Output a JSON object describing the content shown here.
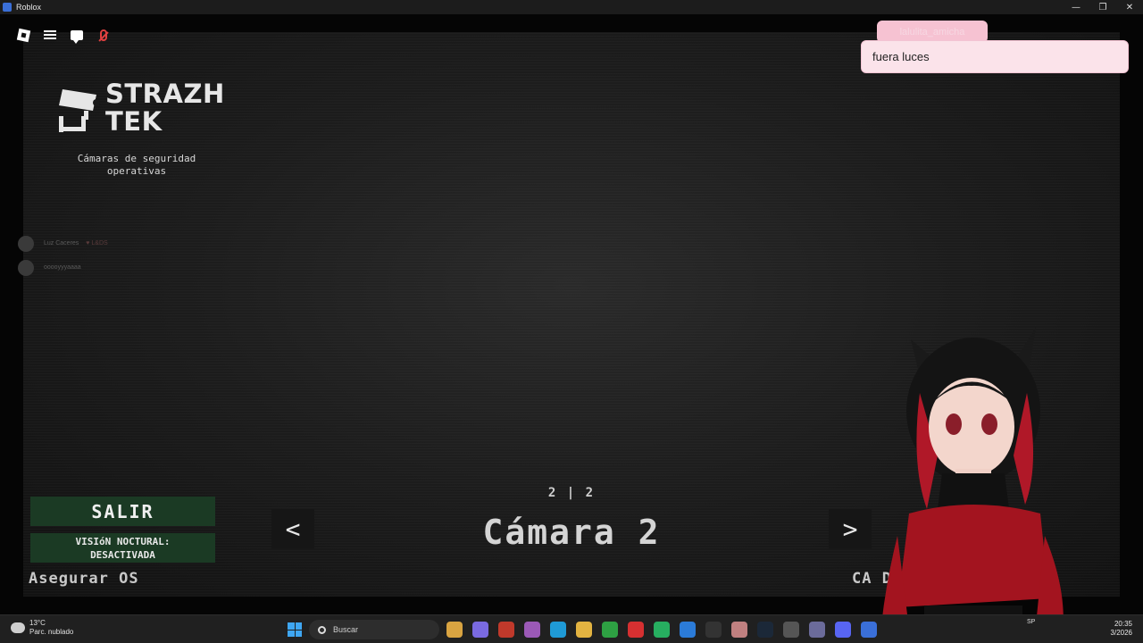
{
  "window": {
    "title": "Roblox",
    "controls": [
      "—",
      "❐",
      "✕"
    ]
  },
  "roblox_bar": {
    "icons": [
      "roblox-logo-icon",
      "menu-icon",
      "chat-icon",
      "mic-muted-icon"
    ]
  },
  "logo": {
    "line1": "STRAZH",
    "line2": "TEK",
    "subtitle_line1": "Cámaras de seguridad",
    "subtitle_line2": "operativas"
  },
  "players": [
    {
      "name": "Luz Caceres",
      "tag": "♥ L&DS"
    },
    {
      "name": "ooooyyyaaaa",
      "tag": ""
    }
  ],
  "chat": {
    "speaker": "lalulita_amicha",
    "message": "fuera luces"
  },
  "buttons": {
    "salir": "SALIR",
    "vision_line1": "VISIóN NOCTURAL:",
    "vision_line2": "DESACTIVADA",
    "asegurar": "Asegurar OS"
  },
  "camera": {
    "counter": "2 | 2",
    "name": "Cámara 2",
    "prev": "<",
    "next": ">",
    "right_label": "CA                    DAD"
  },
  "taskbar": {
    "weather_temp": "13°C",
    "weather_desc": "Parc. nublado",
    "search_placeholder": "Buscar",
    "tray_lang": "SP",
    "time": "20:35",
    "date": "3/2026",
    "apps": [
      {
        "name": "file-explorer-icon",
        "color": "#d9a441"
      },
      {
        "name": "copilot-icon",
        "color": "#7a6ae0"
      },
      {
        "name": "app-red-icon",
        "color": "#c0392b"
      },
      {
        "name": "app-purple-icon",
        "color": "#9b59b6"
      },
      {
        "name": "edge-icon",
        "color": "#1f9ad6"
      },
      {
        "name": "folder-icon",
        "color": "#e3b341"
      },
      {
        "name": "chrome-icon",
        "color": "#2ea043"
      },
      {
        "name": "opera-icon",
        "color": "#d63031"
      },
      {
        "name": "app-green-icon",
        "color": "#27ae60"
      },
      {
        "name": "app-blue-icon",
        "color": "#2b7bd8"
      },
      {
        "name": "app-dark-icon",
        "color": "#333333"
      },
      {
        "name": "app-character-icon",
        "color": "#c08080"
      },
      {
        "name": "steam-icon",
        "color": "#1b2838"
      },
      {
        "name": "app-grey-icon",
        "color": "#555555"
      },
      {
        "name": "app-gear-icon",
        "color": "#6b6b9a"
      },
      {
        "name": "discord-icon",
        "color": "#5865f2"
      },
      {
        "name": "roblox-icon",
        "color": "#3a6fd8"
      }
    ]
  }
}
